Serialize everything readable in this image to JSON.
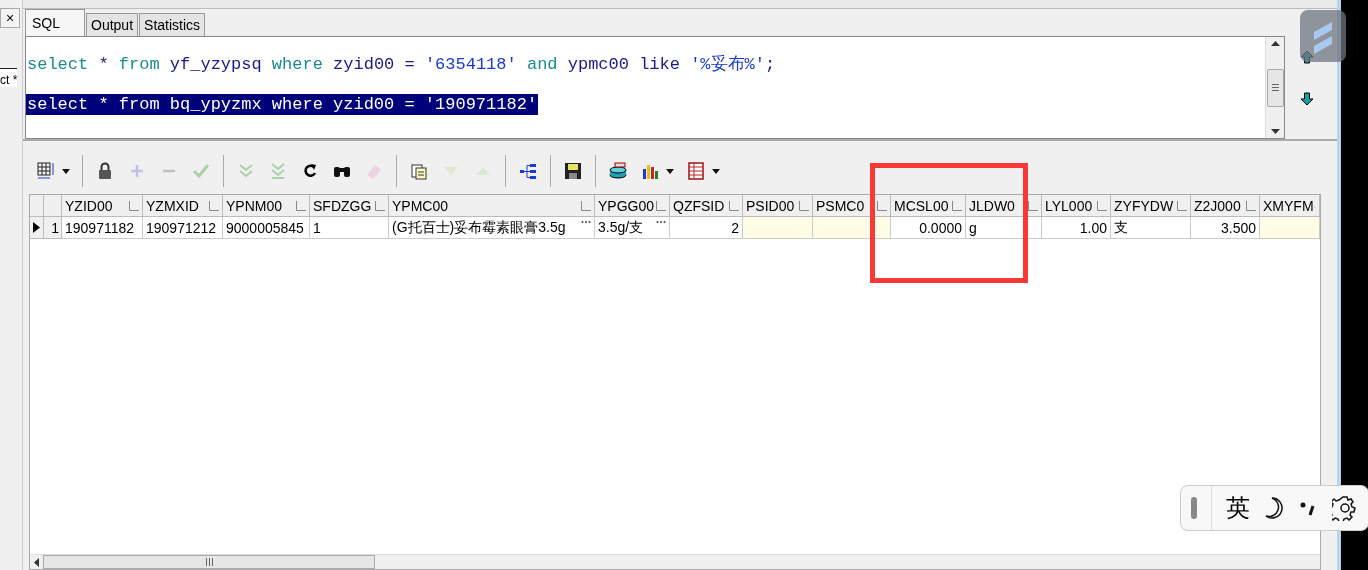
{
  "side_panel": {
    "close": "×",
    "tab_fragment": "ct *"
  },
  "tabs": [
    {
      "label": "SQL",
      "selected": true
    },
    {
      "label": "Output",
      "selected": false
    },
    {
      "label": "Statistics",
      "selected": false
    }
  ],
  "editor": {
    "lines": [
      {
        "selected": false,
        "tokens": [
          {
            "kind": "keyword",
            "text": "select"
          },
          {
            "kind": "identifier",
            "text": " * "
          },
          {
            "kind": "keyword",
            "text": "from"
          },
          {
            "kind": "identifier",
            "text": " yf_yzypsq "
          },
          {
            "kind": "keyword",
            "text": "where"
          },
          {
            "kind": "identifier",
            "text": " zyid00 = "
          },
          {
            "kind": "string",
            "text": "'6354118'"
          },
          {
            "kind": "keyword",
            "text": " and "
          },
          {
            "kind": "identifier",
            "text": "ypmc00 like "
          },
          {
            "kind": "string",
            "text": "'%妥布%'"
          },
          {
            "kind": "identifier",
            "text": ";"
          }
        ]
      },
      {
        "selected": true,
        "text": "select * from bq_ypyzmx where yzid00 = '190971182'"
      }
    ]
  },
  "toolbar": [
    {
      "kind": "grid",
      "disabled": false,
      "dropdown": true
    },
    {
      "kind": "separator"
    },
    {
      "kind": "lock",
      "disabled": false,
      "dropdown": false
    },
    {
      "kind": "plus",
      "disabled": true,
      "dropdown": false
    },
    {
      "kind": "minus",
      "disabled": true,
      "dropdown": false
    },
    {
      "kind": "check",
      "disabled": true,
      "dropdown": false
    },
    {
      "kind": "separator"
    },
    {
      "kind": "double-down",
      "disabled": true,
      "dropdown": false
    },
    {
      "kind": "double-down-bar",
      "disabled": true,
      "dropdown": false
    },
    {
      "kind": "refresh",
      "disabled": false,
      "dropdown": false
    },
    {
      "kind": "binoculars",
      "disabled": false,
      "dropdown": false
    },
    {
      "kind": "eraser",
      "disabled": true,
      "dropdown": false
    },
    {
      "kind": "separator"
    },
    {
      "kind": "documents",
      "disabled": false,
      "dropdown": false
    },
    {
      "kind": "down",
      "disabled": true,
      "dropdown": false
    },
    {
      "kind": "up",
      "disabled": true,
      "dropdown": false
    },
    {
      "kind": "separator"
    },
    {
      "kind": "tree",
      "disabled": false,
      "dropdown": false
    },
    {
      "kind": "separator"
    },
    {
      "kind": "save",
      "disabled": false,
      "dropdown": false
    },
    {
      "kind": "separator"
    },
    {
      "kind": "database",
      "disabled": false,
      "dropdown": false
    },
    {
      "kind": "chart",
      "disabled": false,
      "dropdown": true
    },
    {
      "kind": "table",
      "disabled": false,
      "dropdown": true
    }
  ],
  "grid": {
    "columns": [
      {
        "label": "YZID00",
        "numeric": false
      },
      {
        "label": "YZMXID",
        "numeric": false
      },
      {
        "label": "YPNM00",
        "numeric": false
      },
      {
        "label": "SFDZGG",
        "numeric": false
      },
      {
        "label": "YPMC00",
        "numeric": false
      },
      {
        "label": "YPGG00",
        "numeric": false
      },
      {
        "label": "QZFSID",
        "numeric": true
      },
      {
        "label": "PSID00"
      },
      {
        "label": "PSMC0"
      },
      {
        "label": "MCSL00",
        "numeric": true
      },
      {
        "label": "JLDW0",
        "numeric": false
      },
      {
        "label": "LYL000",
        "numeric": true
      },
      {
        "label": "ZYFYDW",
        "numeric": false
      },
      {
        "label": "Z2J000",
        "numeric": true
      },
      {
        "label": "XMYFM"
      }
    ],
    "rows": [
      {
        "number": "1",
        "current": true,
        "cells": [
          {
            "value": "190971182",
            "null": false,
            "picker": false
          },
          {
            "value": "190971212",
            "null": false,
            "picker": false
          },
          {
            "value": "9000005845",
            "null": false,
            "picker": false
          },
          {
            "value": "1",
            "null": false,
            "picker": false
          },
          {
            "value": "(G托百士)妥布霉素眼膏3.5g",
            "null": false,
            "picker": true
          },
          {
            "value": "3.5g/支",
            "null": false,
            "picker": true
          },
          {
            "value": "2",
            "null": false,
            "picker": false
          },
          {
            "null": true,
            "picker": false
          },
          {
            "null": true,
            "picker": false
          },
          {
            "value": "0.0000",
            "null": false,
            "picker": false
          },
          {
            "value": "g",
            "null": false,
            "picker": false
          },
          {
            "value": "1.00",
            "null": false,
            "picker": false
          },
          {
            "value": "支",
            "null": false,
            "picker": false
          },
          {
            "value": "3.500",
            "null": false,
            "picker": false
          },
          {
            "null": true,
            "picker": false
          }
        ]
      }
    ]
  },
  "input_method_bar": {
    "language": "英"
  }
}
